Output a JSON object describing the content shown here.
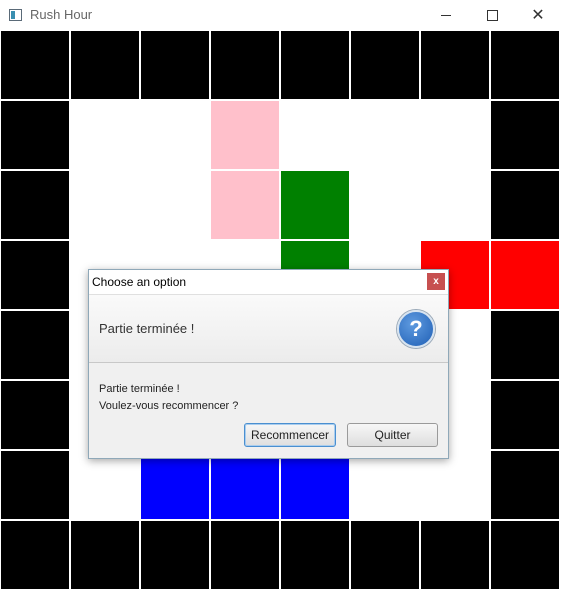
{
  "window": {
    "title": "Rush Hour",
    "minimize_icon": "minimize-icon",
    "maximize_icon": "maximize-icon",
    "close_icon": "close-icon"
  },
  "board": {
    "size": 8,
    "colors": {
      "wall": "#000000",
      "empty": "#ffffff",
      "pink": "#ffc0cb",
      "green": "#008000",
      "red": "#ff0000",
      "blue": "#0000ff"
    },
    "cells": [
      [
        "wall",
        "wall",
        "wall",
        "wall",
        "wall",
        "wall",
        "wall",
        "wall"
      ],
      [
        "wall",
        "empty",
        "empty",
        "pink",
        "empty",
        "empty",
        "empty",
        "wall"
      ],
      [
        "wall",
        "empty",
        "empty",
        "pink",
        "green",
        "empty",
        "empty",
        "wall"
      ],
      [
        "wall",
        "empty",
        "empty",
        "empty",
        "green",
        "empty",
        "red",
        "red"
      ],
      [
        "wall",
        "empty",
        "empty",
        "empty",
        "empty",
        "empty",
        "empty",
        "wall"
      ],
      [
        "wall",
        "empty",
        "empty",
        "empty",
        "empty",
        "empty",
        "empty",
        "wall"
      ],
      [
        "wall",
        "empty",
        "blue",
        "blue",
        "blue",
        "empty",
        "empty",
        "wall"
      ],
      [
        "wall",
        "wall",
        "wall",
        "wall",
        "wall",
        "wall",
        "wall",
        "wall"
      ]
    ]
  },
  "dialog": {
    "title": "Choose an option",
    "close_label": "x",
    "header": "Partie terminée !",
    "icon": "question-icon",
    "icon_glyph": "?",
    "message_line1": "Partie terminée !",
    "message_line2": "Voulez-vous recommencer ?",
    "restart_label": "Recommencer",
    "quit_label": "Quitter"
  }
}
